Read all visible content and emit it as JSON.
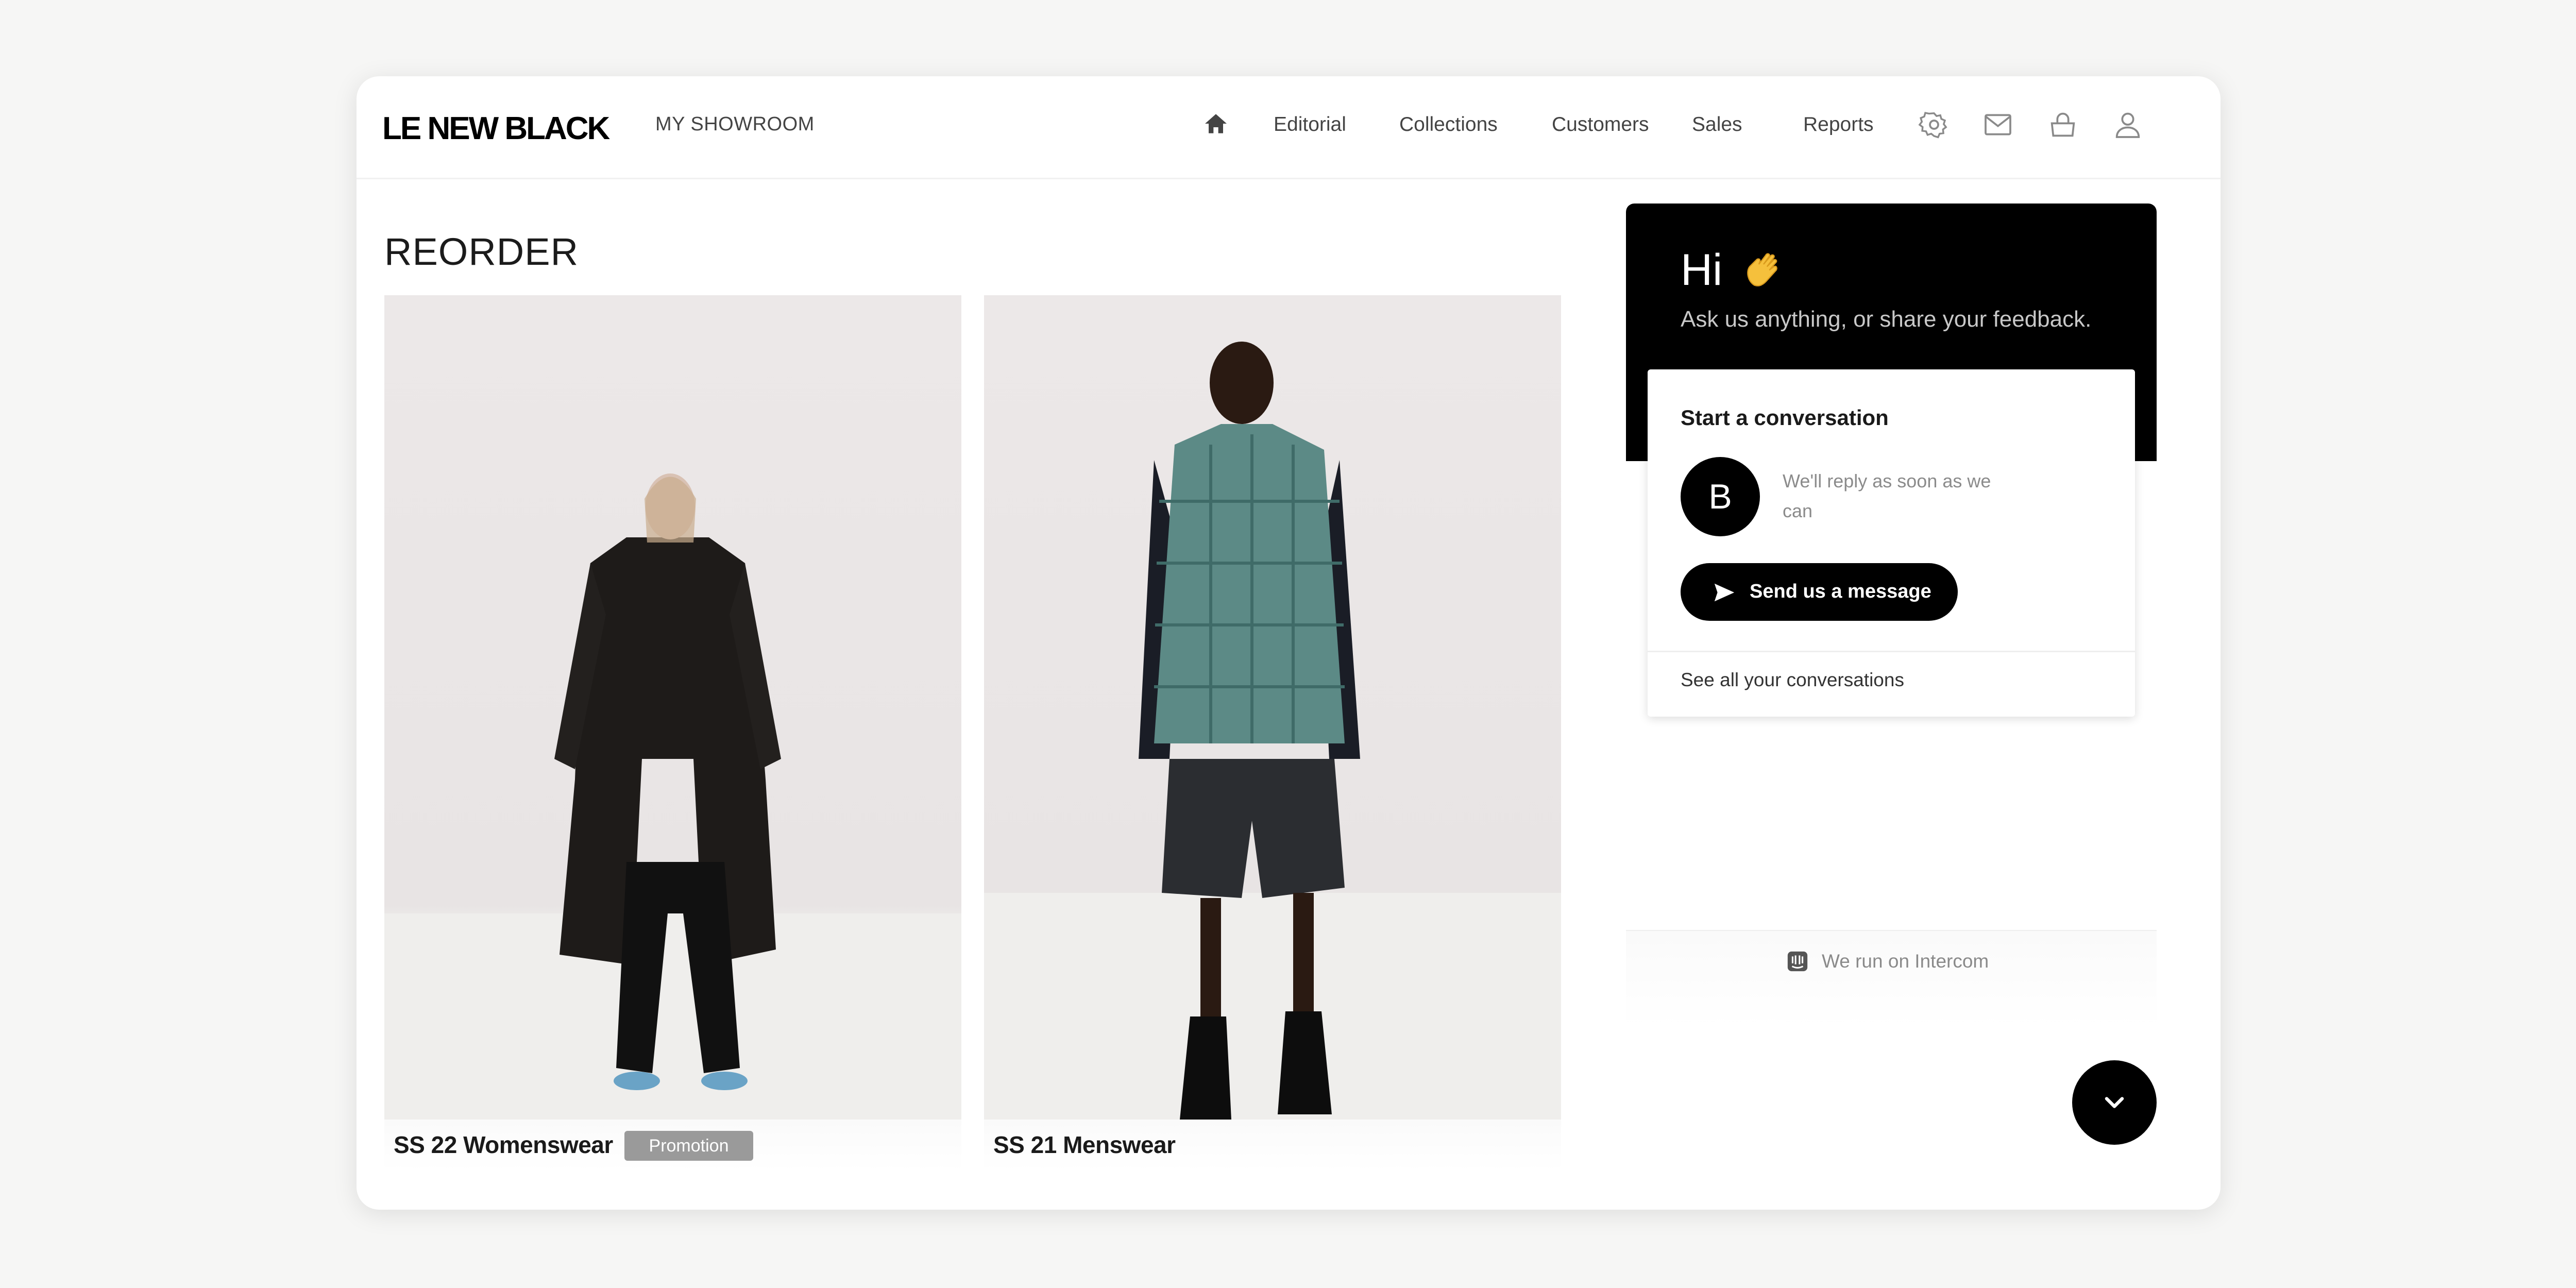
{
  "header": {
    "logo": "LE NEW BLACK",
    "showroom_label": "MY SHOWROOM",
    "nav": [
      "Editorial",
      "Collections",
      "Customers",
      "Sales",
      "Reports"
    ],
    "icons": [
      "home-icon",
      "settings-icon",
      "inbox-icon",
      "basket-icon",
      "user-icon"
    ]
  },
  "main": {
    "title": "REORDER",
    "cards": [
      {
        "title": "SS 22 Womenswear",
        "badge": "Promotion"
      },
      {
        "title": "SS 21 Menswear"
      }
    ]
  },
  "messenger": {
    "greeting": "Hi",
    "subtitle": "Ask us anything, or share your feedback.",
    "conversation": {
      "title": "Start a conversation",
      "avatar_letter": "B",
      "reply_note": "We'll reply as soon as we can",
      "send_label": "Send us a message",
      "see_all": "See all your conversations"
    },
    "footer": "We run on Intercom"
  },
  "colors": {
    "brand": "#000000",
    "badge": "#9a9a9a",
    "background": "#f6f6f5"
  }
}
